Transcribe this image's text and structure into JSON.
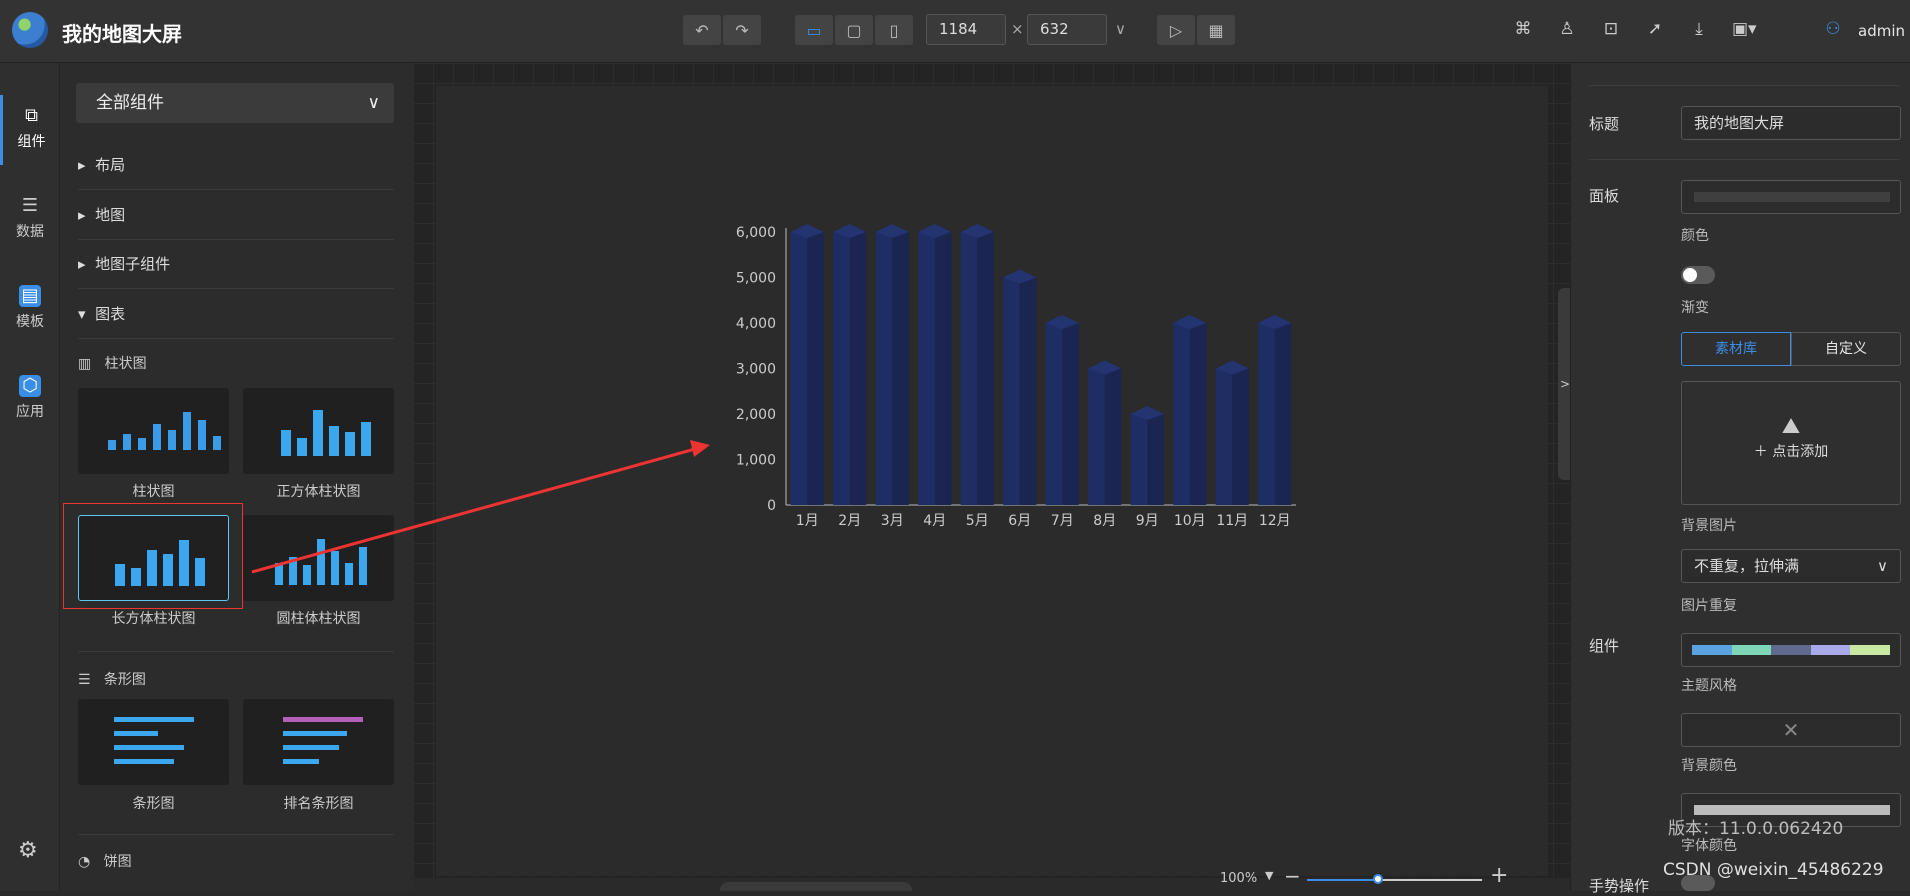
{
  "app": {
    "title": "我的地图大屏",
    "user": "admin"
  },
  "toolbar": {
    "width": "1184",
    "height": "632",
    "x": "×"
  },
  "rail": [
    {
      "label": "组件",
      "icon": "components-icon"
    },
    {
      "label": "数据",
      "icon": "data-icon"
    },
    {
      "label": "模板",
      "icon": "template-icon"
    },
    {
      "label": "应用",
      "icon": "app-icon"
    }
  ],
  "left": {
    "dropdown": "全部组件",
    "sections": [
      "布局",
      "地图",
      "地图子组件",
      "图表"
    ],
    "sub1": "柱状图",
    "sub2": "条形图",
    "sub3": "饼图",
    "thumbs1": [
      "柱状图",
      "正方体柱状图",
      "长方体柱状图",
      "圆柱体柱状图"
    ],
    "thumbs2": [
      "条形图",
      "排名条形图"
    ]
  },
  "chart_data": {
    "type": "bar",
    "categories": [
      "1月",
      "2月",
      "3月",
      "4月",
      "5月",
      "6月",
      "7月",
      "8月",
      "9月",
      "10月",
      "11月",
      "12月"
    ],
    "values": [
      6000,
      6000,
      6000,
      6000,
      6000,
      5000,
      4000,
      3000,
      2000,
      4000,
      3000,
      4000
    ],
    "ylim": [
      0,
      6000
    ],
    "yticks": [
      "0",
      "1,000",
      "2,000",
      "3,000",
      "4,000",
      "5,000",
      "6,000"
    ],
    "colors": {
      "bar": "#1a2552",
      "top": "#1e2d64"
    }
  },
  "right": {
    "title_label": "标题",
    "title_value": "我的地图大屏",
    "panel_label": "面板",
    "color_label": "颜色",
    "gradient_label": "渐变",
    "tab1": "素材库",
    "tab2": "自定义",
    "add_label": "点击添加",
    "bgimg_label": "背景图片",
    "repeat_value": "不重复，拉伸满",
    "repeat_label": "图片重复",
    "comp_label": "组件",
    "theme_label": "主题风格",
    "bgcolor_label": "背景颜色",
    "fontcolor_label": "字体颜色",
    "gesture_label": "手势操作"
  },
  "zoom": "100%",
  "overlay": {
    "version": "版本：11.0.0.062420",
    "csdn": "CSDN @weixin_45486229"
  }
}
